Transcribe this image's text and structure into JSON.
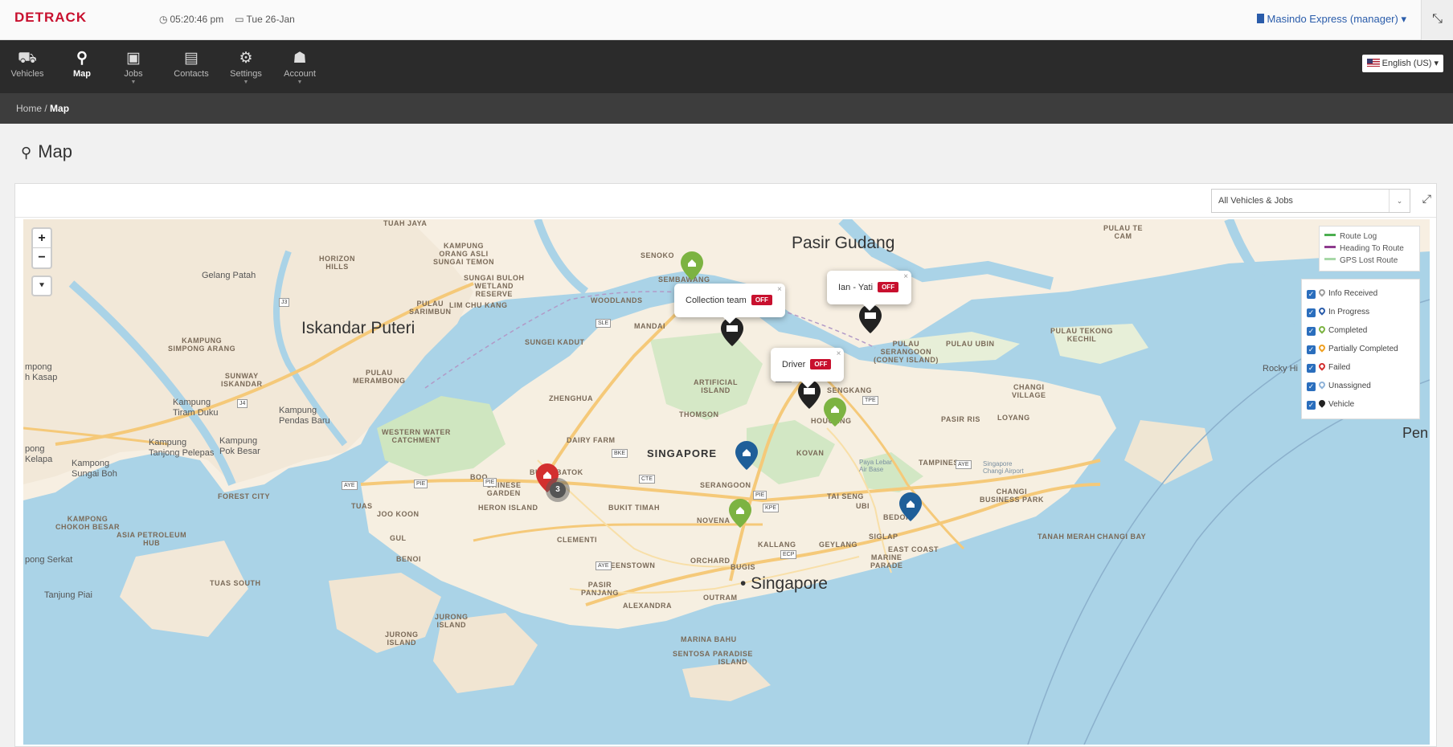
{
  "header": {
    "logo": "DETRACK",
    "time": "05:20:46 pm",
    "date": "Tue 26-Jan",
    "account": "Masindo Express (manager)",
    "account_caret": "▾",
    "expand_icon": "expand-icon"
  },
  "nav": {
    "items": [
      {
        "label": "Vehicles",
        "icon": "car-icon"
      },
      {
        "label": "Map",
        "icon": "map-marker-icon"
      },
      {
        "label": "Jobs",
        "icon": "briefcase-icon"
      },
      {
        "label": "Contacts",
        "icon": "book-icon"
      },
      {
        "label": "Settings",
        "icon": "gear-icon"
      },
      {
        "label": "Account",
        "icon": "user-icon"
      }
    ],
    "language": "English (US)"
  },
  "breadcrumb": {
    "home": "Home",
    "separator": "/",
    "current": "Map"
  },
  "page": {
    "title": "Map"
  },
  "map_panel": {
    "filter_value": "All Vehicles & Jobs",
    "zoom_in": "+",
    "zoom_out": "−",
    "route_legend": [
      {
        "label": "Route Log",
        "color": "#4caf50"
      },
      {
        "label": "Heading To Route",
        "color": "#8e3b8e"
      },
      {
        "label": "GPS Lost Route",
        "color": "#a8d8a8"
      }
    ],
    "status_legend": [
      {
        "label": "Info Received",
        "color": "#9e9e9e"
      },
      {
        "label": "In Progress",
        "color": "#2a5caa"
      },
      {
        "label": "Completed",
        "color": "#7cb342"
      },
      {
        "label": "Partially Completed",
        "color": "#f0a020"
      },
      {
        "label": "Failed",
        "color": "#d32f2f"
      },
      {
        "label": "Unassigned",
        "color": "#8fb3d9"
      },
      {
        "label": "Vehicle",
        "color": "#222222"
      }
    ],
    "popups": [
      {
        "name": "Collection team",
        "status": "OFF"
      },
      {
        "name": "Ian - Yati",
        "status": "OFF"
      },
      {
        "name": "Driver",
        "status": "OFF"
      }
    ],
    "cluster_count": "3",
    "places": {
      "pasir_gudang": "Pasir Gudang",
      "iskandar_puteri": "Iskandar Puteri",
      "singapore_city": "• Singapore",
      "singapore_region": "SINGAPORE",
      "gelang_patah": "Gelang Patah",
      "kampung_tiram_duku": "Kampung\nTiram Duku",
      "kampung_pendas_baru": "Kampung\nPendas Baru",
      "kampung_tanjong_pelepas": "Kampung\nTanjong Pelepas",
      "kampung_pok_besar": "Kampung\nPok Besar",
      "kampung_sungai_boh": "Kampong\nSungai Boh",
      "pong_kelapa": "pong\nKelapa",
      "mpong_kasap": "mpong\nh Kasap",
      "pong_serkat": "pong Serkat",
      "tanjung_piai": "Tanjung Piai",
      "rocky_hill": "Rocky Hi",
      "pen": "Pen",
      "paya_lebar": "Paya Lebar\nAir Base",
      "changi_airport": "Singapore\nChangi Airport"
    },
    "districts": [
      "TUAH JAYA",
      "KAMPUNG\nORANG ASLI\nSUNGAI TEMON",
      "SENOKO",
      "SEMBAWANG",
      "HORIZON\nHILLS",
      "SUNGAI BULOH\nWETLAND\nRESERVE",
      "PULAU\nSARIMBUN",
      "LIM CHU KANG",
      "WOODLANDS",
      "MANDAI",
      "SUNGEI KADUT",
      "KAMPUNG\nSIMPONG ARANG",
      "SUNWAY\nISKANDAR",
      "PULAU\nMERAMBONG",
      "ARTIFICIAL\nISLAND",
      "ZHENGHUA",
      "THOMSON",
      "SENGKANG",
      "HOUGANG",
      "PULAU\nSERANGOON\n(CONEY ISLAND)",
      "PULAU UBIN",
      "PULAU TEKONG\nKECHIL",
      "CHANGI\nVILLAGE",
      "PASIR RIS",
      "LOYANG",
      "WESTERN WATER\nCATCHMENT",
      "DAIRY FARM",
      "BOO",
      "CHINESE\nGARDEN",
      "BUKIT BATOK",
      "FOREST CITY",
      "TUAS",
      "JOO KOON",
      "HERON ISLAND",
      "BUKIT TIMAH",
      "NOVENA",
      "KOVAN",
      "SERANGOON",
      "TAMPINES",
      "TAI SENG",
      "UBI",
      "BEDOK",
      "CHANGI\nBUSINESS PARK",
      "TANAH MERAH",
      "CHANGI BAY",
      "KAMPONG\nCHOKOH BESAR",
      "ASIA PETROLEUM\nHUB",
      "GUL",
      "CLEMENTI",
      "BENOI",
      "QUEENSTOWN",
      "ORCHARD",
      "KALLANG",
      "GEYLANG",
      "SIGLAP",
      "EAST COAST",
      "MARINE\nPARADE",
      "BUGIS",
      "TUAS SOUTH",
      "PASIR\nPANJANG",
      "ALEXANDRA",
      "OUTRAM",
      "JURONG\nISLAND",
      "JURONG\nISLAND",
      "MARINA BAHU",
      "SENTOSA",
      "PARADISE\nISLAND",
      "PULAU TE\nCAM"
    ],
    "road_shields": [
      "J3",
      "J4",
      "SLE",
      "TPE",
      "TPE",
      "BKE",
      "PIE",
      "AYE",
      "PIE",
      "CTE",
      "PIE",
      "ECP",
      "AYE",
      "KPE",
      "AYE"
    ]
  }
}
